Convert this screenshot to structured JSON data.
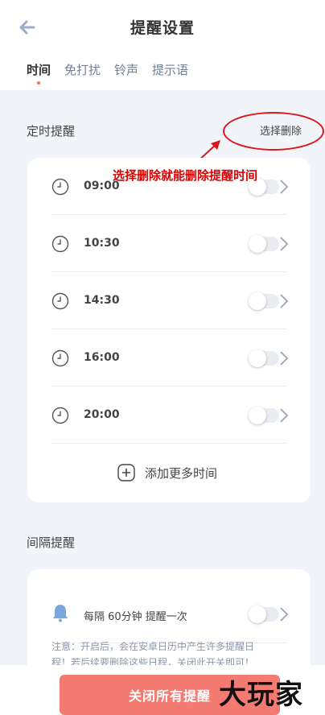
{
  "header": {
    "title": "提醒设置",
    "back_icon": "arrow-left-icon"
  },
  "tabs": [
    {
      "label": "时间",
      "active": true
    },
    {
      "label": "免打扰",
      "active": false
    },
    {
      "label": "铃声",
      "active": false
    },
    {
      "label": "提示语",
      "active": false
    }
  ],
  "timed": {
    "title": "定时提醒",
    "select_delete": "选择删除",
    "annotation": "选择删除就能删除提醒时间",
    "items": [
      {
        "time": "09:00",
        "enabled": false
      },
      {
        "time": "10:30",
        "enabled": false
      },
      {
        "time": "14:30",
        "enabled": false
      },
      {
        "time": "16:00",
        "enabled": false
      },
      {
        "time": "20:00",
        "enabled": false
      }
    ],
    "add_more": "添加更多时间"
  },
  "interval": {
    "title": "间隔提醒",
    "row_text": "每隔 60分钟 提醒一次",
    "enabled": false,
    "note_line1": "注意：开启后，会在安卓日历中产生许多提醒日",
    "note_line2": "程！若后续要删除这些日程，关闭此开关即可！"
  },
  "footer": {
    "close_all": "关闭所有提醒"
  },
  "watermark": "大玩家",
  "colors": {
    "accent_dot": "#ff6a4d",
    "close_button": "#f47b72",
    "annotation": "#dd0000",
    "background": "#f1f4f9"
  }
}
